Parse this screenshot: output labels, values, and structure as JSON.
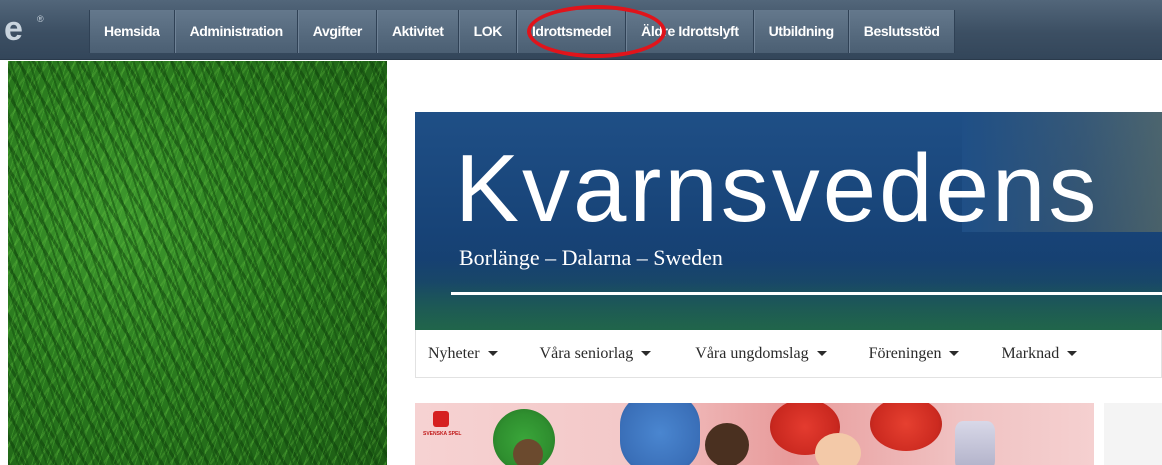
{
  "topbar": {
    "logo_fragment": "e",
    "logo_mark": "®",
    "nav": [
      {
        "label": "Hemsida"
      },
      {
        "label": "Administration"
      },
      {
        "label": "Avgifter"
      },
      {
        "label": "Aktivitet"
      },
      {
        "label": "LOK"
      },
      {
        "label": "Idrottsmedel",
        "highlighted": true
      },
      {
        "label": "Äldre Idrottslyft"
      },
      {
        "label": "Utbildning"
      },
      {
        "label": "Beslutsstöd"
      }
    ],
    "highlight_color": "#e0141b"
  },
  "site": {
    "banner": {
      "title": "Kvarnsvedens",
      "subtitle": "Borlänge – Dalarna – Sweden"
    },
    "menu": [
      {
        "label": "Nyheter"
      },
      {
        "label": "Våra seniorlag"
      },
      {
        "label": "Våra ungdomslag"
      },
      {
        "label": "Föreningen"
      },
      {
        "label": "Marknad"
      }
    ],
    "ad": {
      "brand": "SVENSKA SPEL"
    }
  },
  "colors": {
    "topbar": "#3c4f63",
    "banner": "#1f4f86",
    "grass": "#2a7a1e"
  }
}
